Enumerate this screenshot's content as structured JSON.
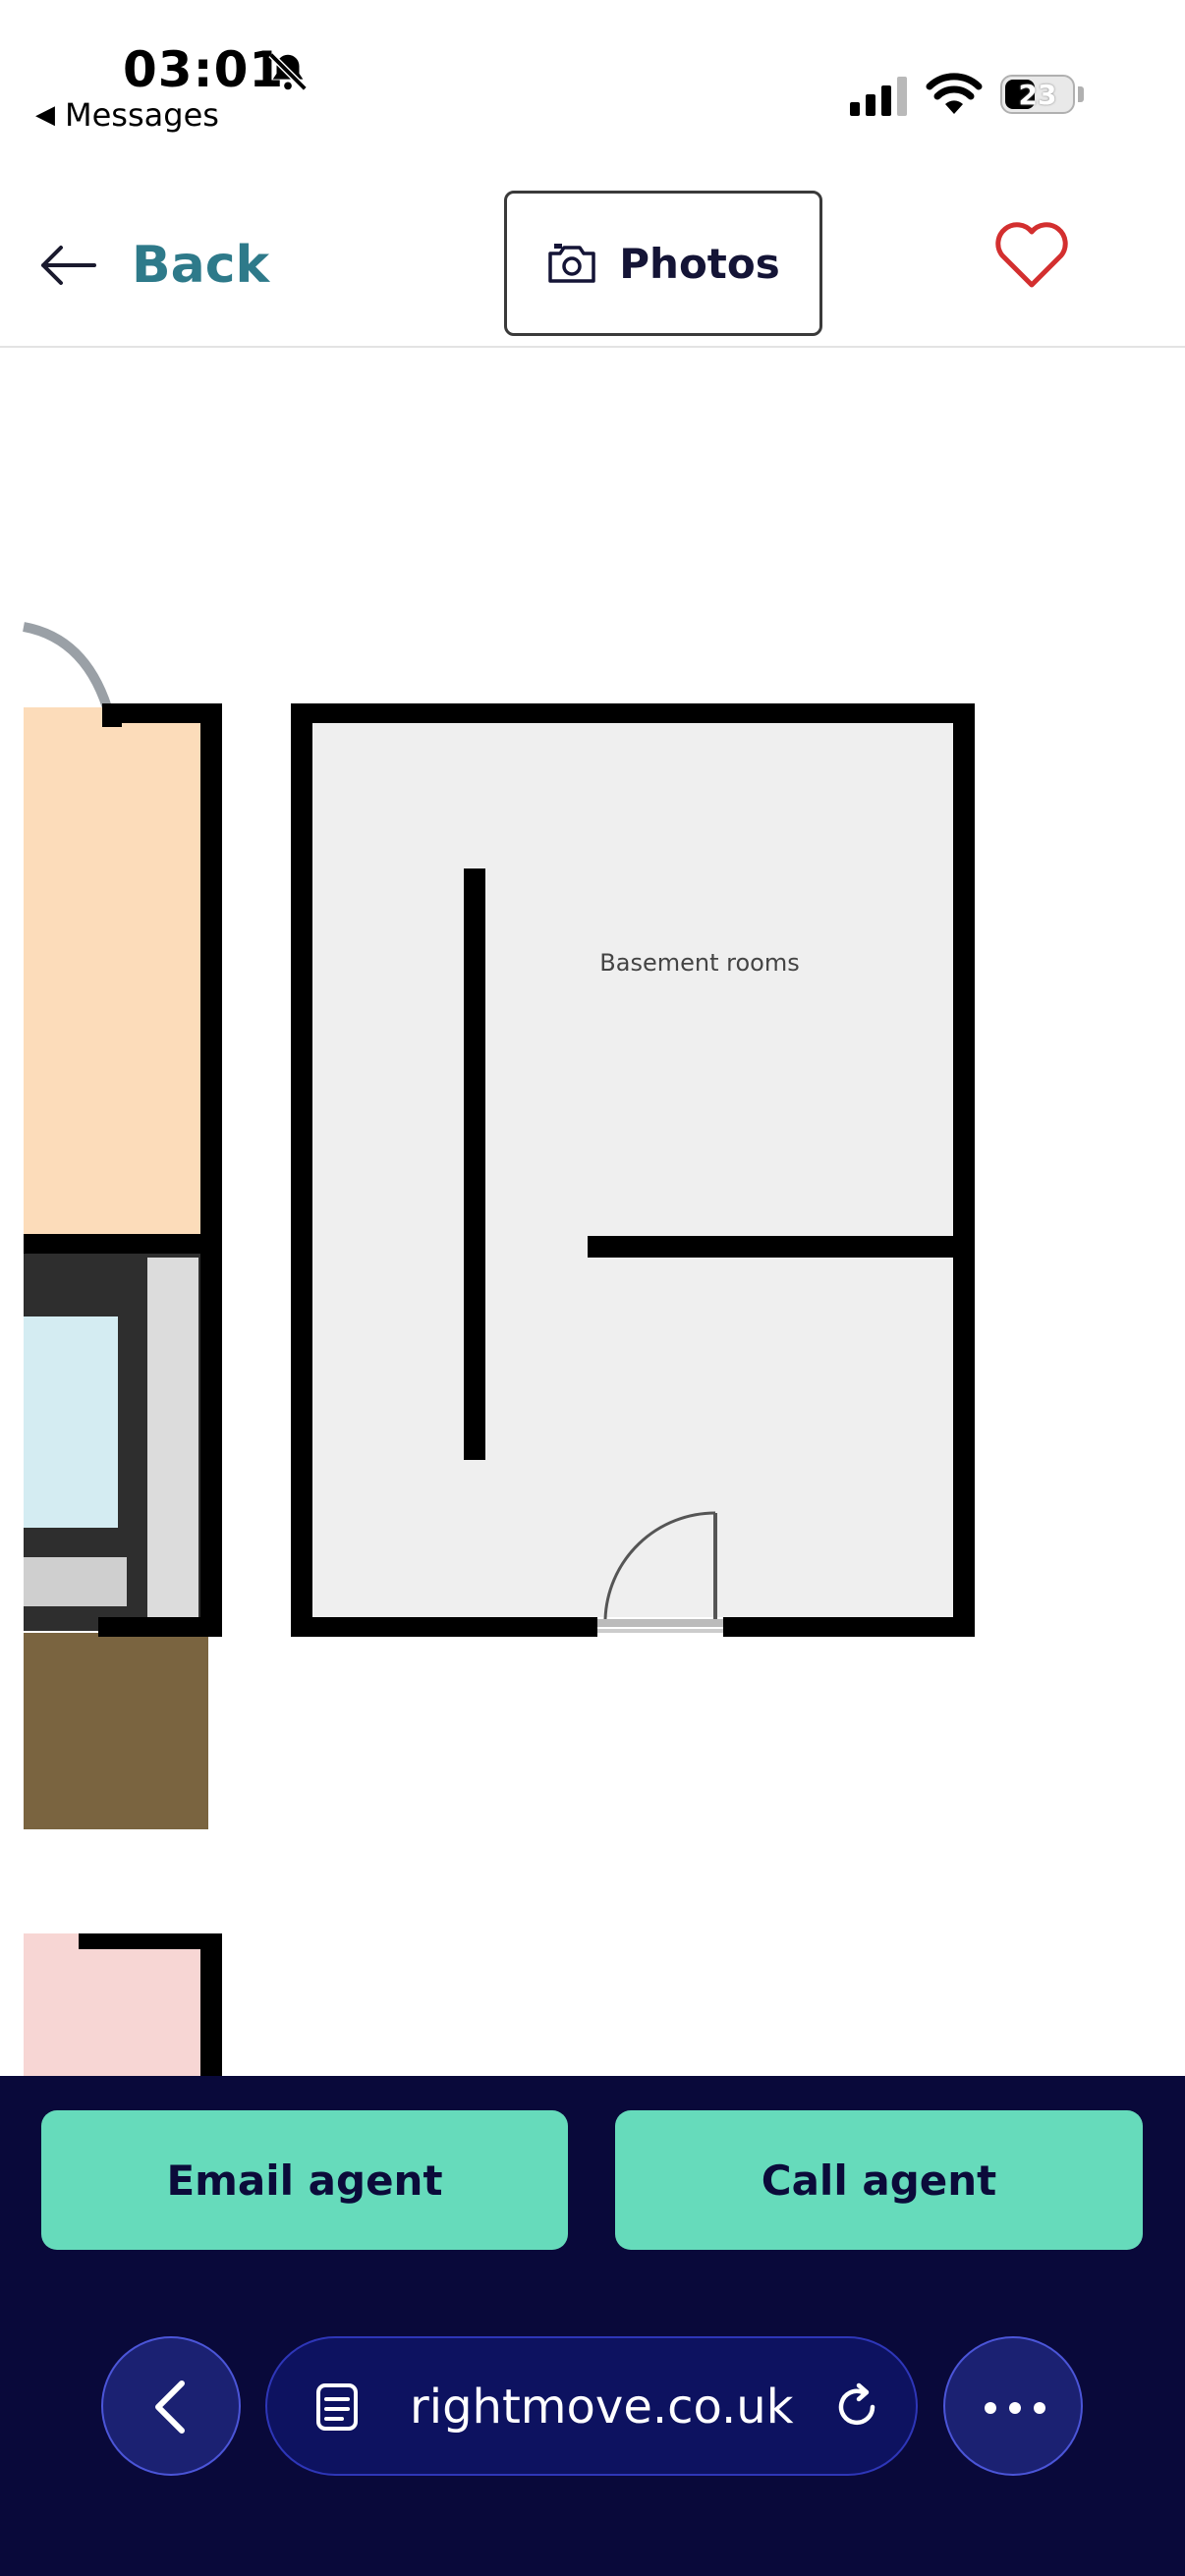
{
  "status_bar": {
    "time": "03:01",
    "back_app_label": "Messages",
    "battery_level": "23",
    "icons": [
      "bell-slash-icon",
      "signal-icon",
      "wifi-icon",
      "battery-icon"
    ]
  },
  "nav": {
    "back_label": "Back",
    "photos_label": "Photos",
    "icons": [
      "arrow-left-icon",
      "camera-icon",
      "heart-icon"
    ],
    "colors": {
      "back": "#2e7a8a",
      "heart": "#d32f2f"
    }
  },
  "floorplan": {
    "room_label": "Basement rooms"
  },
  "actions": {
    "email_label": "Email agent",
    "call_label": "Call agent",
    "button_color": "#66dbbb"
  },
  "browser": {
    "url": "rightmove.co.uk",
    "icons": [
      "chevron-left-icon",
      "tabs-icon",
      "reload-icon",
      "more-icon"
    ],
    "bar_color": "#09093a"
  }
}
